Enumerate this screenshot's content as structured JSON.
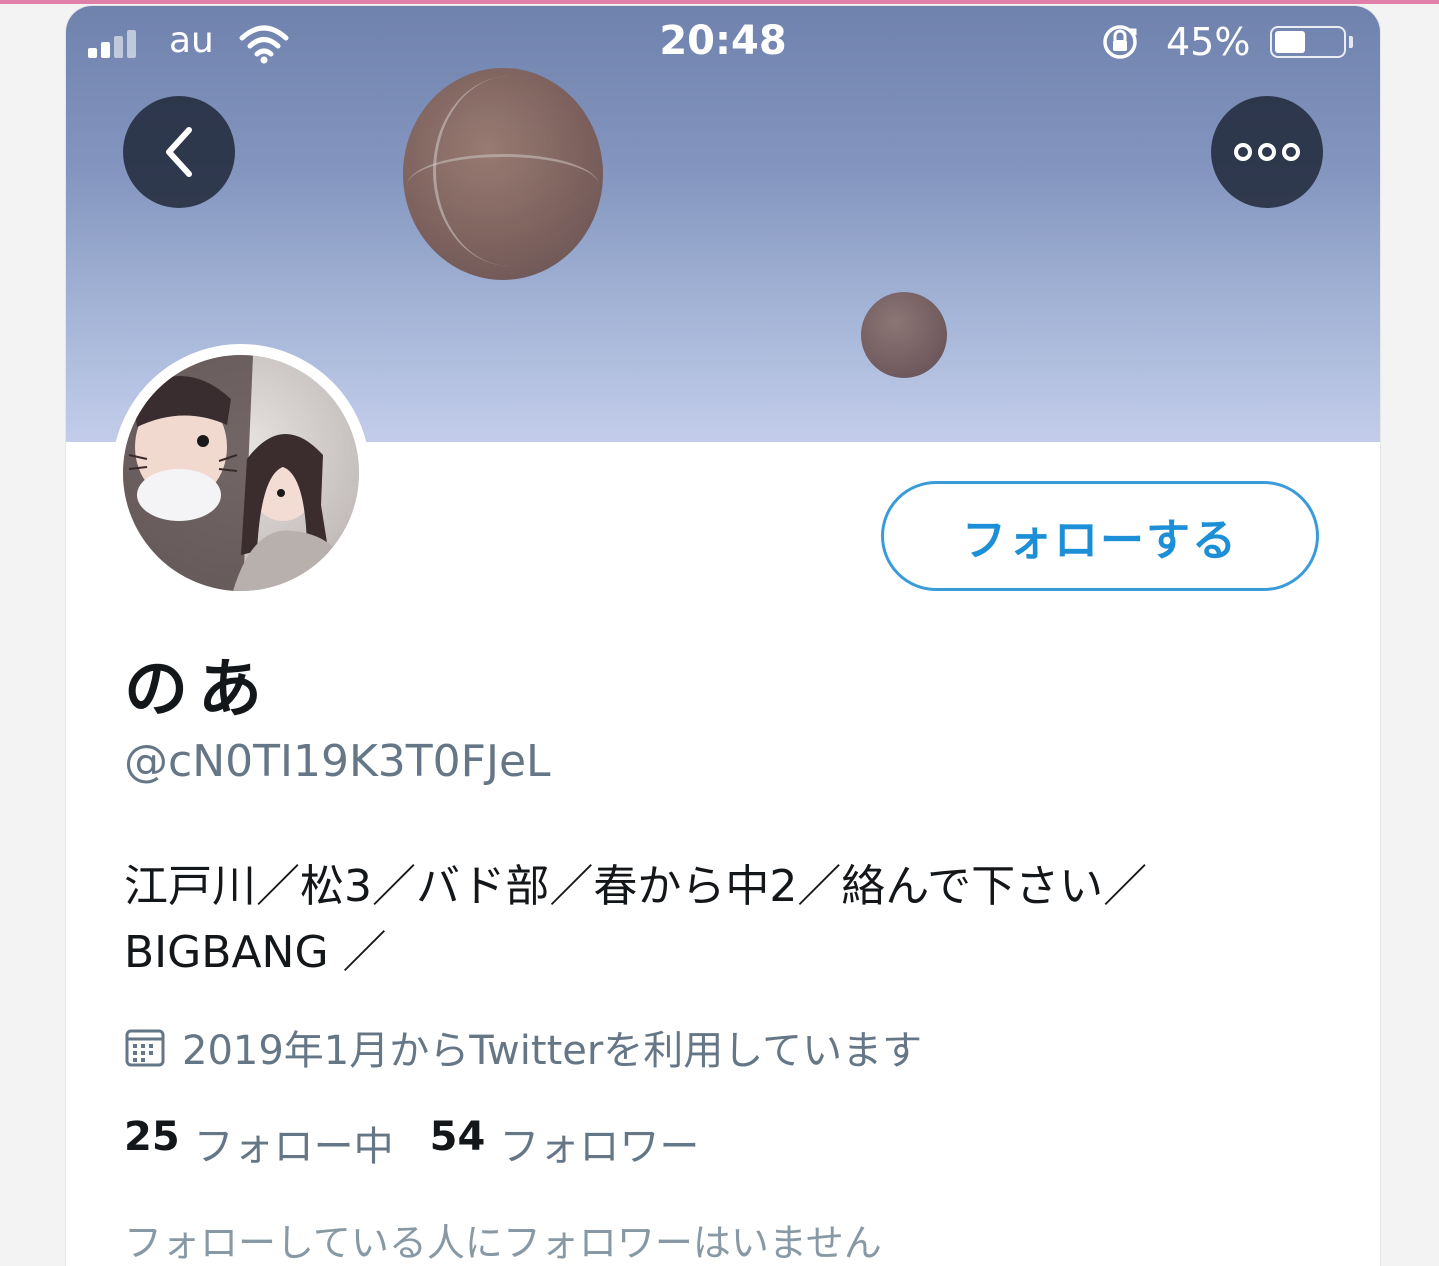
{
  "status_bar": {
    "carrier": "au",
    "time": "20:48",
    "battery_percent": "45%",
    "battery_level": 0.45,
    "signal_bars": 2,
    "signal_icon": "signal-bars-icon",
    "wifi_icon": "wifi-icon",
    "lock_icon": "orientation-lock-icon"
  },
  "header": {
    "back_icon": "chevron-left-icon",
    "more_icon": "more-horizontal-icon"
  },
  "profile": {
    "display_name": "のあ",
    "handle": "@cN0TI19K3T0FJeL",
    "bio_line1": "江戸川／松3／バド部／春から中2／絡んで下さい／",
    "bio_line2": "BIGBANG ／",
    "joined_icon": "calendar-icon",
    "joined": "2019年1月からTwitterを利用しています",
    "following_count": "25",
    "following_label": "フォロー中",
    "followers_count": "54",
    "followers_label": "フォロワー",
    "follow_note": "フォローしている人にフォロワーはいません"
  },
  "actions": {
    "follow_label": "フォローする"
  },
  "colors": {
    "accent": "#1d8fd6",
    "header_top": "#6f82ad",
    "header_bottom": "#c3cdea",
    "secondary_text": "#657786"
  }
}
